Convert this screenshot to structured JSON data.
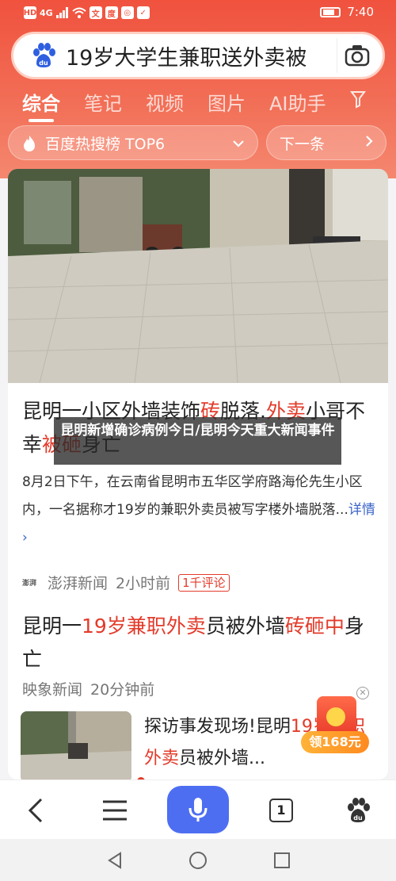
{
  "status_bar": {
    "left_icons": [
      "HD",
      "4G"
    ],
    "time": "7:40"
  },
  "search": {
    "query": "19岁大学生兼职送外卖被"
  },
  "tabs": [
    {
      "label": "综合",
      "active": true
    },
    {
      "label": "笔记",
      "active": false
    },
    {
      "label": "视频",
      "active": false
    },
    {
      "label": "图片",
      "active": false
    },
    {
      "label": "AI助手",
      "active": false
    }
  ],
  "hot_search": {
    "label": "百度热搜榜 TOP6",
    "next_label": "下一条"
  },
  "article1": {
    "title_a": "昆明一小区外墙装饰",
    "title_hl1": "砖",
    "title_b": "脱落",
    "title_c": ".",
    "title_hl2": "外卖",
    "title_d": "小哥不幸",
    "title_hl3": "被砸",
    "title_e": "身亡",
    "summary": "8月2日下午，在云南省昆明市五华区学府路海伦先生小区内，一名据称才19岁的兼职外卖员被写字楼外墙脱落...",
    "more_label": "详情",
    "source_logo": "澎湃",
    "source": "澎湃新闻",
    "time": "2小时前",
    "comments": "1千评论"
  },
  "article2": {
    "title_a": "昆明一",
    "title_hl1": "19岁兼职外卖",
    "title_b": "员被外墙",
    "title_hl2": "砖砸中",
    "title_c": "身亡",
    "source": "映象新闻",
    "time": "20分钟前",
    "snippet_a": "探访事发现场!昆明",
    "snippet_hl": "19岁兼职外卖",
    "snippet_b": "员被外墙..."
  },
  "overlay_caption": "昆明新增确诊病例今日/昆明今天重大新闻事件",
  "red_packet": {
    "label": "领168元"
  },
  "bottom_nav": {
    "tab_count": "1"
  },
  "colors": {
    "brand_red": "#f0523e",
    "highlight_red": "#e33b2a",
    "mic_blue": "#4e6ef2"
  }
}
